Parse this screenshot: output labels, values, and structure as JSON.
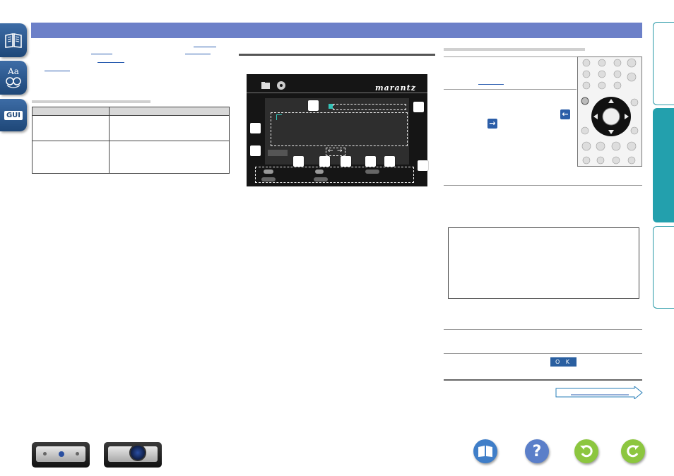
{
  "icons": {
    "manual": "book-icon",
    "glossary": "glossary-icon",
    "gui": "gui-icon"
  },
  "sidebar": {
    "gui_label": "GUI",
    "glossary_label": "Aa"
  },
  "screen": {
    "brand_logo": "marantz"
  },
  "dialog": {
    "ok_label": "O K"
  },
  "colors": {
    "banner": "#6c80c8",
    "accent_tab": "#23a0ad",
    "link": "#2a5db0"
  }
}
